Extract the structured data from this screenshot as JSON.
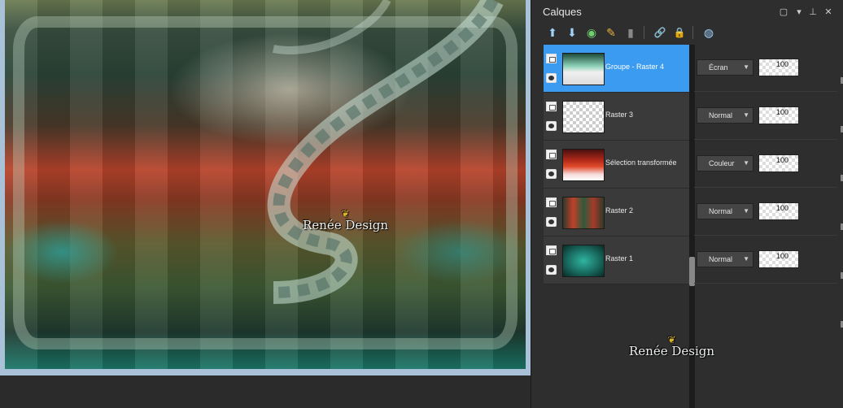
{
  "canvas": {
    "watermark": "Renée Design"
  },
  "layers_panel": {
    "title": "Calques",
    "header_buttons": [
      {
        "name": "maximize-icon",
        "glyph": "▢"
      },
      {
        "name": "menu-icon",
        "glyph": "▾"
      },
      {
        "name": "pin-icon",
        "glyph": "⊥"
      },
      {
        "name": "close-icon",
        "glyph": "✕"
      }
    ],
    "toolbar": [
      {
        "name": "new-layer-icon",
        "glyph": "⬆"
      },
      {
        "name": "new-raster-icon",
        "glyph": "⬇"
      },
      {
        "name": "visibility-icon",
        "glyph": "◉"
      },
      {
        "name": "properties-icon",
        "glyph": "✎"
      },
      {
        "name": "mask-icon",
        "glyph": "▮"
      },
      {
        "name": "link-icon",
        "glyph": "🔗"
      },
      {
        "name": "lock-icon",
        "glyph": "🔒"
      },
      {
        "name": "palette-icon",
        "glyph": "◍"
      }
    ],
    "layers": [
      {
        "name": "Groupe - Raster 4",
        "blend": "Écran",
        "opacity": "100",
        "selected": true,
        "thumb": "t-group"
      },
      {
        "name": "Raster 3",
        "blend": "Normal",
        "opacity": "100",
        "selected": false,
        "thumb": "t-empty"
      },
      {
        "name": "Sélection transformée",
        "blend": "Couleur",
        "opacity": "100",
        "selected": false,
        "thumb": "t-sel"
      },
      {
        "name": "Raster 2",
        "blend": "Normal",
        "opacity": "100",
        "selected": false,
        "thumb": "t-r2"
      },
      {
        "name": "Raster 1",
        "blend": "Normal",
        "opacity": "100",
        "selected": false,
        "thumb": "t-r1"
      }
    ],
    "watermark": "Renée Design"
  }
}
